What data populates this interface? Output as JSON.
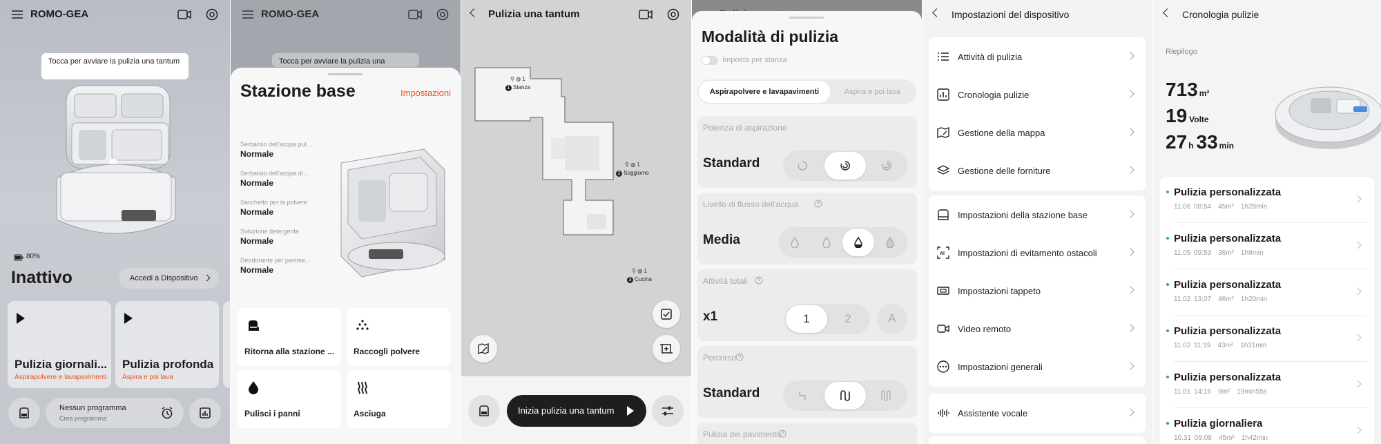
{
  "p1": {
    "device_name": "ROMO-GEA",
    "tooltip": "Tocca per avviare la pulizia una tantum",
    "battery": "80%",
    "status": "Inattivo",
    "device_button": "Accedi a Dispositivo",
    "modes": [
      {
        "title": "Pulizia giornali...",
        "sub": "Aspirapolvere e lavapavimenti"
      },
      {
        "title": "Pulizia profonda",
        "sub": "Aspira e poi lava"
      }
    ],
    "schedule_title": "Nessun programma",
    "schedule_sub": "Crea programma"
  },
  "p2": {
    "device_name": "ROMO-GEA",
    "tooltip": "Tocca per avviare la pulizia una",
    "title": "Stazione base",
    "settings_link": "Impostazioni",
    "specs": [
      {
        "label": "Serbatoio dell'acqua pul...",
        "value": "Normale"
      },
      {
        "label": "Serbatoio dell'acqua di ...",
        "value": "Normale"
      },
      {
        "label": "Sacchetto per la polvere",
        "value": "Normale"
      },
      {
        "label": "Soluzione detergente",
        "value": "Normale"
      },
      {
        "label": "Deodorante per pavime...",
        "value": "Normale"
      }
    ],
    "actions": [
      "Ritorna alla stazione ...",
      "Raccogli polvere",
      "Pulisci i panni",
      "Asciuga"
    ]
  },
  "p3": {
    "title": "Pulizia una tantum",
    "rooms": [
      {
        "num": "1",
        "name": "Stanza",
        "badge": "1"
      },
      {
        "num": "2",
        "name": "Soggiorno",
        "badge": "1"
      },
      {
        "num": "3",
        "name": "Cucina",
        "badge": "1"
      }
    ],
    "start_button": "Inizia pulizia una tantum"
  },
  "p4": {
    "header_peek": "Pulizia una tantum",
    "title": "Modalità di pulizia",
    "per_room": "Imposta per stanza",
    "tabs": [
      "Aspirapolvere e lavapavimenti",
      "Aspira e poi lava"
    ],
    "suction": {
      "label": "Potenza di aspirazione",
      "value": "Standard",
      "selected": 1
    },
    "water": {
      "label": "Livello di flusso dell'acqua",
      "value": "Media",
      "selected": 2
    },
    "passes": {
      "label": "Attività totali",
      "value": "x1",
      "options": [
        "1",
        "2",
        "A"
      ],
      "selected": 0
    },
    "route": {
      "label": "Percorso",
      "value": "Standard",
      "selected": 1
    },
    "floor": {
      "label": "Pulizia del pavimento"
    }
  },
  "p5": {
    "title": "Impostazioni del dispositivo",
    "groups": [
      [
        {
          "icon": "list-icon",
          "label": "Attività di pulizia"
        },
        {
          "icon": "chart-icon",
          "label": "Cronologia pulizie"
        },
        {
          "icon": "map-icon",
          "label": "Gestione della mappa"
        },
        {
          "icon": "layers-icon",
          "label": "Gestione delle forniture"
        }
      ],
      [
        {
          "icon": "base-station-icon",
          "label": "Impostazioni della stazione base"
        },
        {
          "icon": "ai-obstacle-icon",
          "label": "Impostazioni di evitamento ostacoli"
        },
        {
          "icon": "carpet-icon",
          "label": "Impostazioni tappeto"
        },
        {
          "icon": "video-icon",
          "label": "Video remoto"
        },
        {
          "icon": "more-icon",
          "label": "Impostazioni generali"
        }
      ],
      [
        {
          "icon": "voice-icon",
          "label": "Assistente vocale"
        }
      ]
    ]
  },
  "p6": {
    "title": "Cronologia pulizie",
    "summary_label": "Riepilogo",
    "area": "713",
    "area_unit": "m²",
    "times": "19",
    "times_unit": "Volte",
    "hours": "27",
    "hours_unit": "h",
    "minutes": "33",
    "minutes_unit": "min",
    "records": [
      {
        "title": "Pulizia personalizzata",
        "date": "11.06 08:54",
        "area": "45m²",
        "dur": "1h28min"
      },
      {
        "title": "Pulizia personalizzata",
        "date": "11.05 09:53",
        "area": "36m²",
        "dur": "1h9min"
      },
      {
        "title": "Pulizia personalizzata",
        "date": "11.02 13:07",
        "area": "46m²",
        "dur": "1h20min"
      },
      {
        "title": "Pulizia personalizzata",
        "date": "11.02 11:19",
        "area": "43m²",
        "dur": "1h31min"
      },
      {
        "title": "Pulizia personalizzata",
        "date": "11.01 14:16",
        "area": "9m²",
        "dur": "19min55s"
      },
      {
        "title": "Pulizia giornaliera",
        "date": "10.31 09:08",
        "area": "45m²",
        "dur": "1h42min"
      }
    ]
  },
  "colors": {
    "accent": "#e8541e",
    "text": "#1c1c1c",
    "muted": "#9a9a9a",
    "success": "#22b56a"
  }
}
